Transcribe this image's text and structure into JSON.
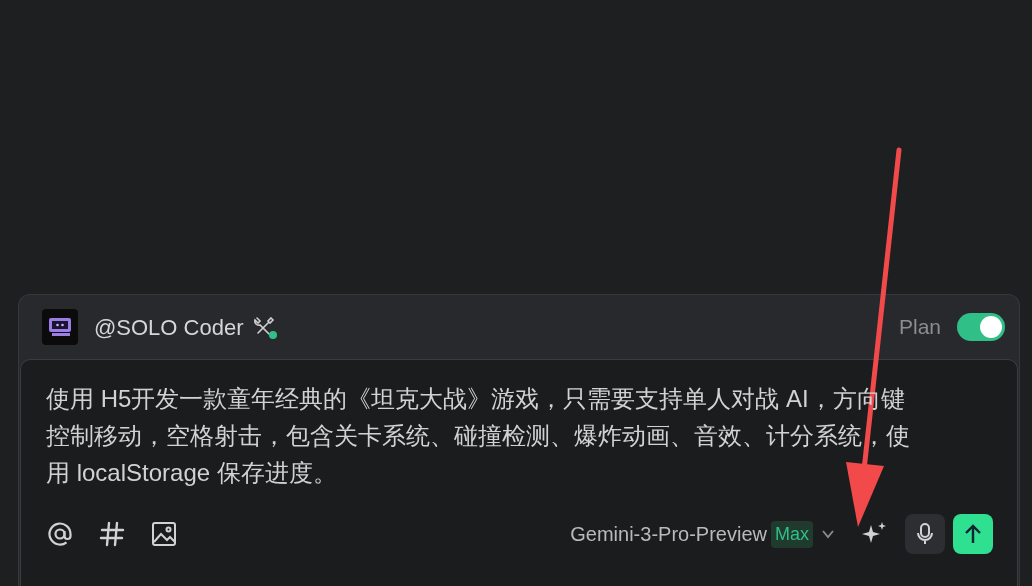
{
  "agent": {
    "name": "@SOLO Coder",
    "online": true
  },
  "plan": {
    "label": "Plan",
    "on": true
  },
  "prompt": {
    "value": "使用 H5开发一款童年经典的《坦克大战》游戏，只需要支持单人对战 AI，方向键控制移动，空格射击，包含关卡系统、碰撞检测、爆炸动画、音效、计分系统，使用 localStorage 保存进度。"
  },
  "toolbar": {
    "model": "Gemini-3-Pro-Preview",
    "badge": "Max"
  }
}
